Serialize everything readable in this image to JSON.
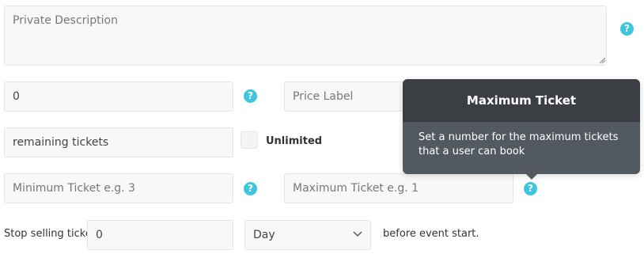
{
  "private_description": {
    "placeholder": "Private Description"
  },
  "price": {
    "value": "0",
    "label_placeholder": "Price Label"
  },
  "remaining": {
    "value": "remaining tickets",
    "unlimited_label": "Unlimited"
  },
  "min_ticket": {
    "placeholder": "Minimum Ticket e.g. 3"
  },
  "max_ticket": {
    "placeholder": "Maximum Ticket e.g. 1"
  },
  "stop_selling": {
    "label": "Stop selling ticket",
    "value": "0",
    "unit": "Day",
    "suffix": "before event start."
  },
  "tooltip": {
    "title": "Maximum Ticket",
    "text": "Set a number for the maximum tickets that a user can book"
  },
  "help_icon_glyph": "?",
  "colors": {
    "help_icon": "#3ec6df",
    "tooltip_header": "#3b3f44",
    "tooltip_body": "#535960"
  }
}
